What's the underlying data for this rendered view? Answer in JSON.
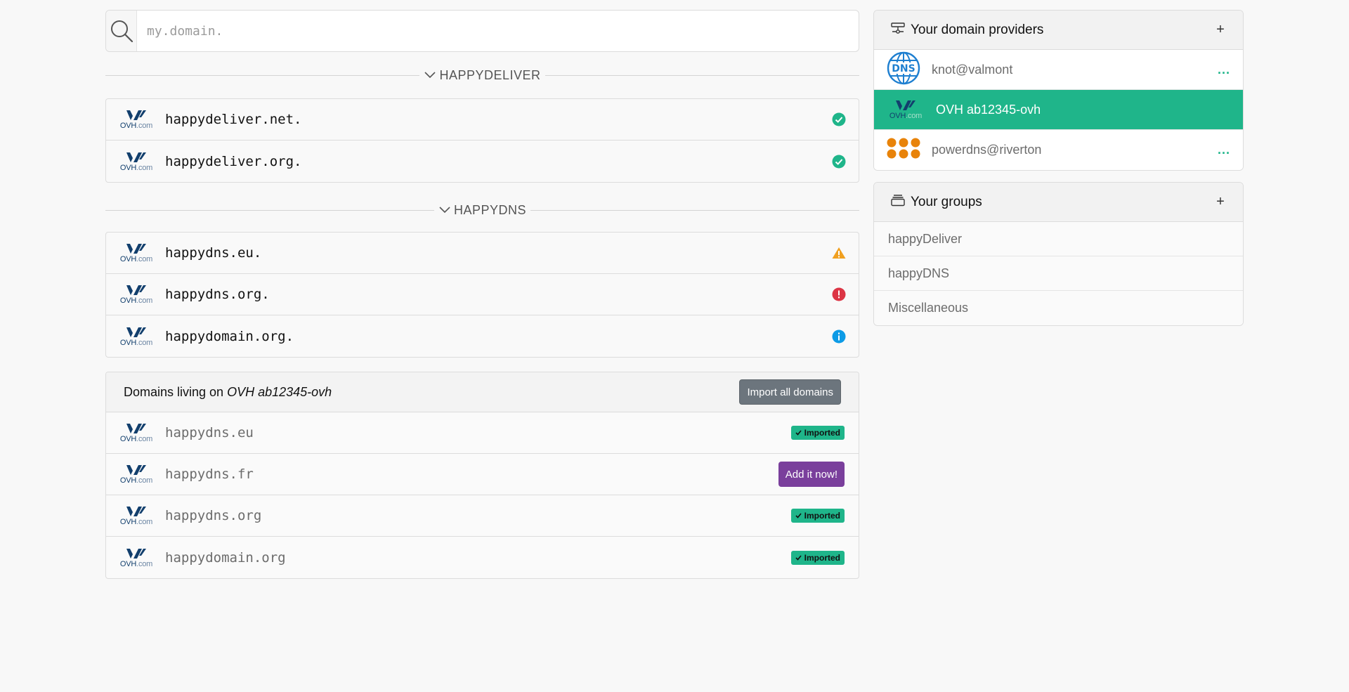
{
  "search": {
    "placeholder": "my.domain.",
    "icon": "search-icon"
  },
  "groups": [
    {
      "label": "HAPPYDELIVER",
      "domains": [
        {
          "name": "happydeliver.net.",
          "status": "ok"
        },
        {
          "name": "happydeliver.org.",
          "status": "ok"
        }
      ]
    },
    {
      "label": "HAPPYDNS",
      "domains": [
        {
          "name": "happydns.eu.",
          "status": "warning"
        },
        {
          "name": "happydns.org.",
          "status": "error"
        },
        {
          "name": "happydomain.org.",
          "status": "info"
        }
      ]
    }
  ],
  "provider_domains": {
    "title_prefix": "Domains living on",
    "provider_name": "OVH ab12345-ovh",
    "import_all_label": "Import all domains",
    "imported_label": "Imported",
    "add_label": "Add it now!",
    "items": [
      {
        "name": "happydns.eu",
        "imported": true
      },
      {
        "name": "happydns.fr",
        "imported": false
      },
      {
        "name": "happydns.org",
        "imported": true
      },
      {
        "name": "happydomain.org",
        "imported": true
      }
    ]
  },
  "logo_text": {
    "brand": "OVH",
    "suffix": ".com",
    "dns": "DNS"
  },
  "sidebar": {
    "providers": {
      "title": "Your domain providers",
      "add_label": "+",
      "more_label": "...",
      "items": [
        {
          "name": "knot@valmont",
          "logo": "dns-globe-icon",
          "active": false
        },
        {
          "name": "OVH ab12345-ovh",
          "logo": "ovh-logo-icon",
          "active": true
        },
        {
          "name": "powerdns@riverton",
          "logo": "powerdns-logo-icon",
          "active": false
        }
      ]
    },
    "groups": {
      "title": "Your groups",
      "add_label": "+",
      "items": [
        "happyDeliver",
        "happyDNS",
        "Miscellaneous"
      ]
    }
  },
  "colors": {
    "accent": "#1fb58a",
    "warning": "#f0a020",
    "error": "#dc3545",
    "info": "#0d9be6",
    "add_button": "#7a3f9c",
    "import_button": "#6c757d"
  }
}
